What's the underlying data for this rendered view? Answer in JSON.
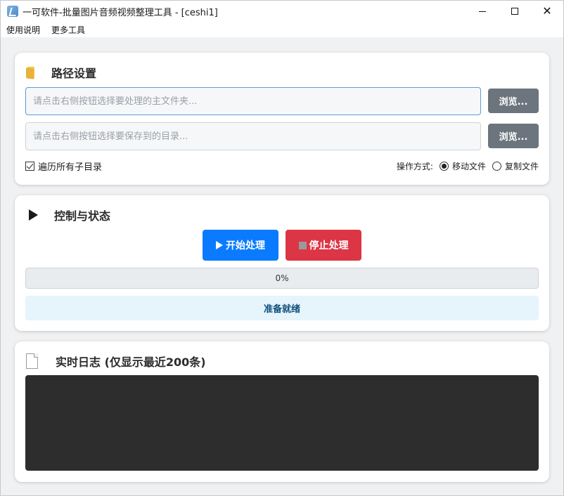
{
  "window": {
    "title": "一可软件-批量图片音频视频整理工具 - [ceshi1]",
    "icons": {
      "app": "app-icon",
      "minimize": "minimize-icon",
      "maximize": "maximize-icon",
      "close": "close-icon"
    }
  },
  "menu": {
    "items": [
      {
        "label": "使用说明"
      },
      {
        "label": "更多工具"
      }
    ]
  },
  "path_settings": {
    "title": "路径设置",
    "icon": "folder-icon",
    "source_input": {
      "value": "",
      "placeholder": "请点击右侧按钮选择要处理的主文件夹..."
    },
    "target_input": {
      "value": "",
      "placeholder": "请点击右侧按钮选择要保存到的目录..."
    },
    "browse_label": "浏览...",
    "recursive_checkbox": {
      "label": "遍历所有子目录",
      "checked": true
    },
    "operation": {
      "label": "操作方式:",
      "options": [
        {
          "label": "移动文件",
          "selected": true
        },
        {
          "label": "复制文件",
          "selected": false
        }
      ]
    }
  },
  "control": {
    "title": "控制与状态",
    "icon": "play-icon",
    "start_label": "开始处理",
    "stop_label": "停止处理",
    "progress": {
      "value": 0,
      "text": "0%"
    },
    "status": "准备就绪"
  },
  "log": {
    "title": "实时日志 (仅显示最近200条)",
    "icon": "document-icon",
    "lines": []
  },
  "colors": {
    "primary": "#0a7bff",
    "danger": "#dc3545",
    "secondary": "#6c757d",
    "status_bg": "#e6f4fc",
    "status_text": "#0d4f7a",
    "log_bg": "#2d2d2d"
  }
}
